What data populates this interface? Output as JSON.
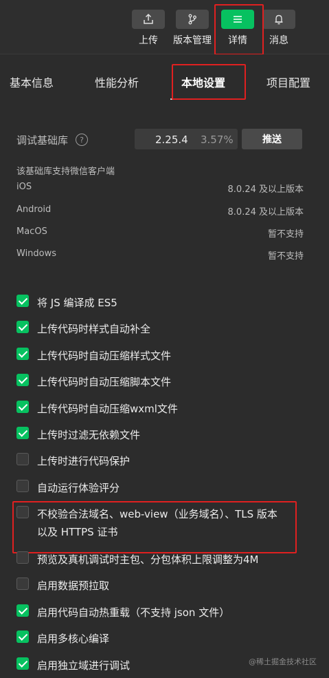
{
  "toolbar": {
    "items": [
      {
        "label": "上传",
        "icon": "upload-icon",
        "active": false
      },
      {
        "label": "版本管理",
        "icon": "branch-icon",
        "active": false
      },
      {
        "label": "详情",
        "icon": "menu-icon",
        "active": true
      },
      {
        "label": "消息",
        "icon": "bell-icon",
        "active": false
      }
    ]
  },
  "tabs": [
    {
      "label": "基本信息"
    },
    {
      "label": "性能分析"
    },
    {
      "label": "本地设置"
    },
    {
      "label": "项目配置"
    }
  ],
  "library": {
    "label": "调试基础库",
    "version": "2.25.4",
    "percent": "3.57%",
    "push_label": "推送"
  },
  "support": {
    "title": "该基础库支持微信客户端",
    "rows": [
      {
        "name": "iOS",
        "value": "8.0.24 及以上版本"
      },
      {
        "name": "Android",
        "value": "8.0.24 及以上版本"
      },
      {
        "name": "MacOS",
        "value": "暂不支持"
      },
      {
        "name": "Windows",
        "value": "暂不支持"
      }
    ]
  },
  "options": [
    {
      "label": "将 JS 编译成 ES5",
      "checked": true
    },
    {
      "label": "上传代码时样式自动补全",
      "checked": true
    },
    {
      "label": "上传代码时自动压缩样式文件",
      "checked": true
    },
    {
      "label": "上传代码时自动压缩脚本文件",
      "checked": true
    },
    {
      "label": "上传代码时自动压缩wxml文件",
      "checked": true
    },
    {
      "label": "上传时过滤无依赖文件",
      "checked": true
    },
    {
      "label": "上传时进行代码保护",
      "checked": false
    },
    {
      "label": "自动运行体验评分",
      "checked": false
    },
    {
      "label": "不校验合法域名、web-view（业务域名）、TLS 版本以及 HTTPS 证书",
      "checked": false
    },
    {
      "label": "预览及真机调试时主包、分包体积上限调整为4M",
      "checked": false
    },
    {
      "label": "启用数据预拉取",
      "checked": false
    },
    {
      "label": "启用代码自动热重载（不支持 json 文件）",
      "checked": true
    },
    {
      "label": "启用多核心编译",
      "checked": true
    },
    {
      "label": "启用独立域进行调试",
      "checked": true
    }
  ],
  "watermark": "@稀土掘金技术社区"
}
